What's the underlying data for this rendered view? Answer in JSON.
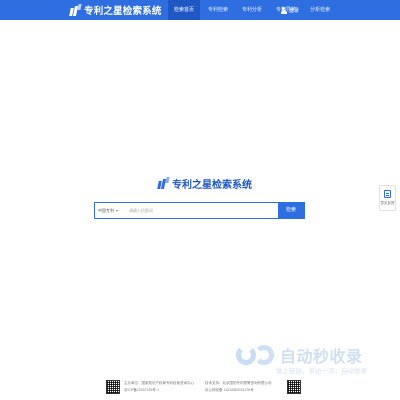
{
  "header": {
    "brand": "专利之星检索系统",
    "nav": [
      {
        "label": "检索首页",
        "active": true
      },
      {
        "label": "专利检索",
        "active": false
      },
      {
        "label": "专利分析",
        "active": false
      },
      {
        "label": "专利导航",
        "active": false
      },
      {
        "label": "分析检索",
        "active": false
      }
    ],
    "login": "登录"
  },
  "center": {
    "brand": "专利之星检索系统"
  },
  "search": {
    "scope": "中国专利",
    "placeholder": "请输入检索词",
    "button": "检索"
  },
  "side_widget": {
    "label": "意见反馈"
  },
  "watermark": {
    "title": "自动秒收录",
    "subtitle": "做上链接，来访一次，自动收录"
  },
  "footer": {
    "line1": "主办单位：国家知识产权局专利检索咨询中心",
    "line2": "京ICP备12037195号-1",
    "line3": "技术支持：北京国知专利预警咨询有限公司",
    "line4": "京公网安备 11010802021178号"
  },
  "colors": {
    "primary": "#2f6ee0",
    "primary_dark": "#1f57c4",
    "background": "#ffffff"
  }
}
